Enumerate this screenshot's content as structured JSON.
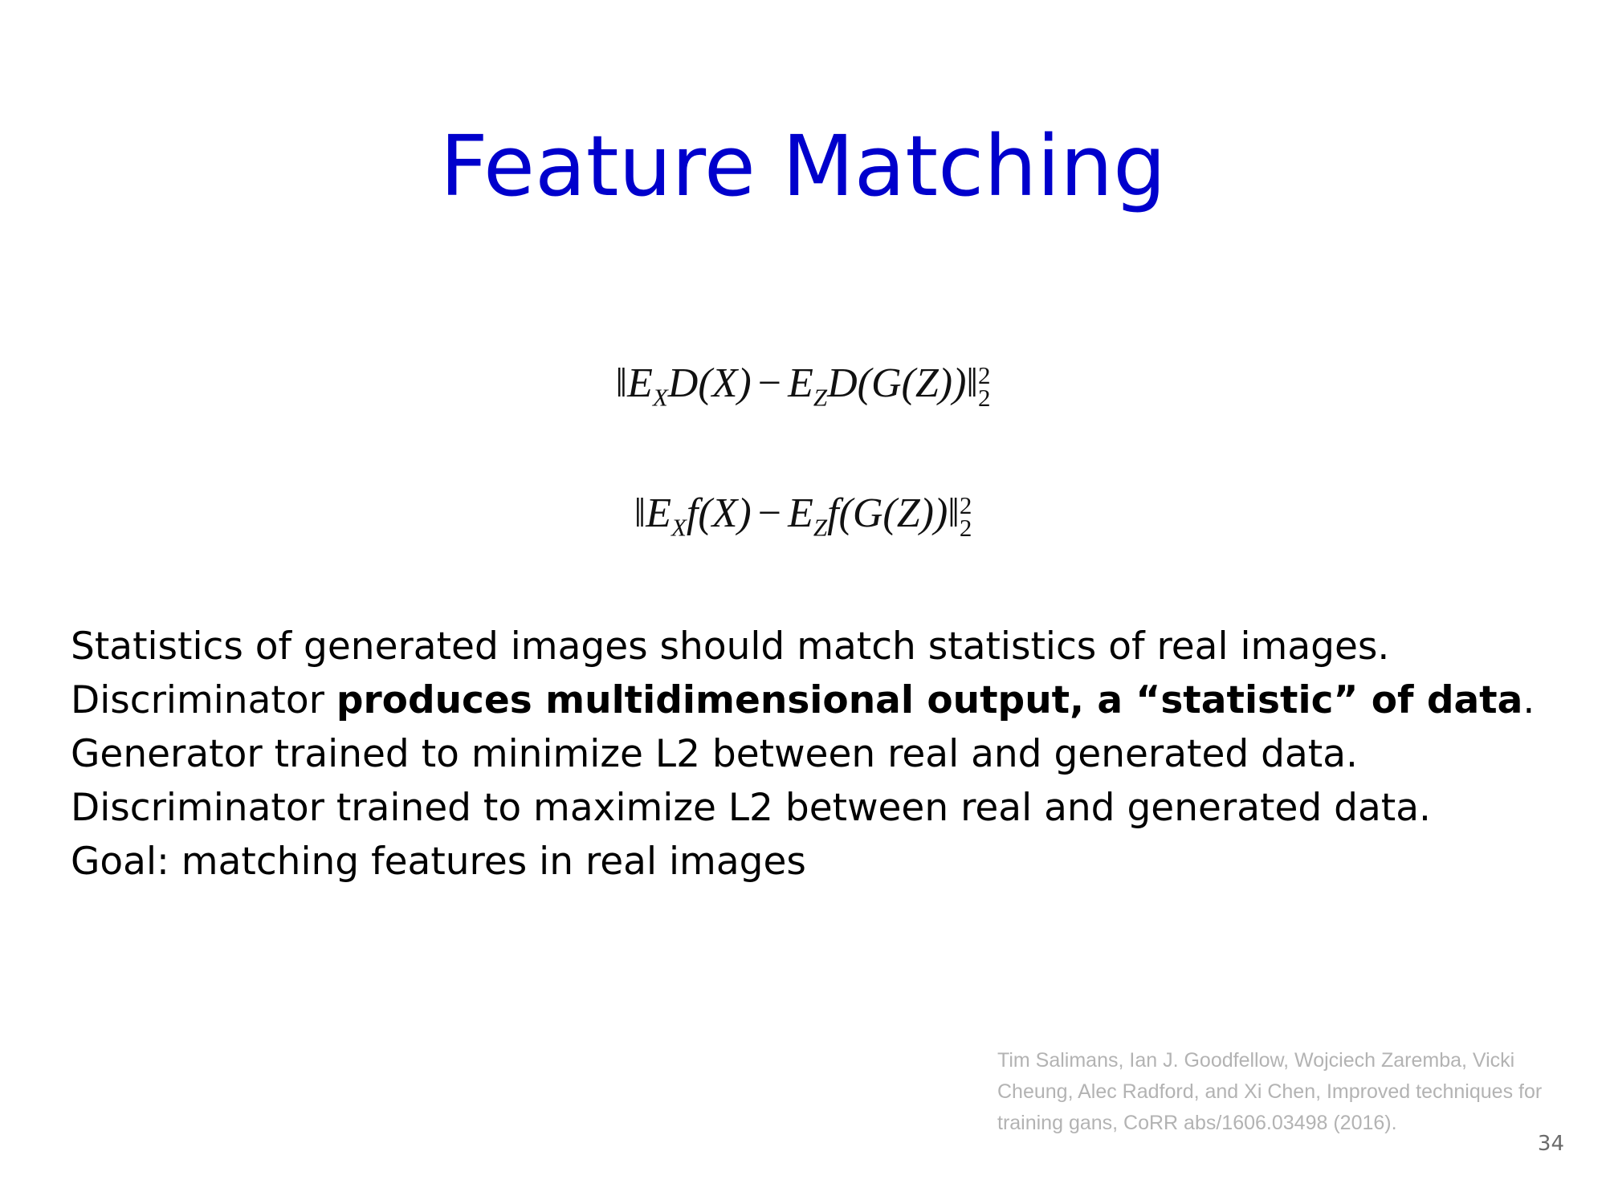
{
  "slide": {
    "title": "Feature Matching",
    "equations": [
      {
        "open": "‖",
        "E1": "E",
        "sub1": "X",
        "fn1": "D(X)",
        "minus": "−",
        "E2": "E",
        "sub2": "Z",
        "fn2": "D(G(Z))",
        "close": "‖",
        "sup": "2",
        "sub": "2"
      },
      {
        "open": "‖",
        "E1": "E",
        "sub1": "X",
        "fn1": "f(X)",
        "minus": "−",
        "E2": "E",
        "sub2": "Z",
        "fn2": "f(G(Z))",
        "close": "‖",
        "sup": "2",
        "sub": "2"
      }
    ],
    "body": {
      "line1": "Statistics of generated images should match statistics of real images.",
      "line2_prefix": "Discriminator ",
      "line2_bold": "produces multidimensional output, a “statistic” of data",
      "line2_suffix": ".",
      "line3": "Generator trained to minimize L2 between real and generated data.",
      "line4": "Discriminator trained to maximize L2 between real and generated data.",
      "line5": "Goal: matching features in real images"
    },
    "citation": {
      "line1": "Tim Salimans, Ian J. Goodfellow, Wojciech Zaremba, Vicki",
      "line2": "Cheung, Alec Radford, and Xi Chen, Improved techniques for",
      "line3": "training gans, CoRR abs/1606.03498 (2016)."
    },
    "page_number": "34",
    "colors": {
      "title": "#0000cc",
      "body": "#000000",
      "citation": "#b3b3b3",
      "page_number": "#6b6b6b"
    }
  }
}
